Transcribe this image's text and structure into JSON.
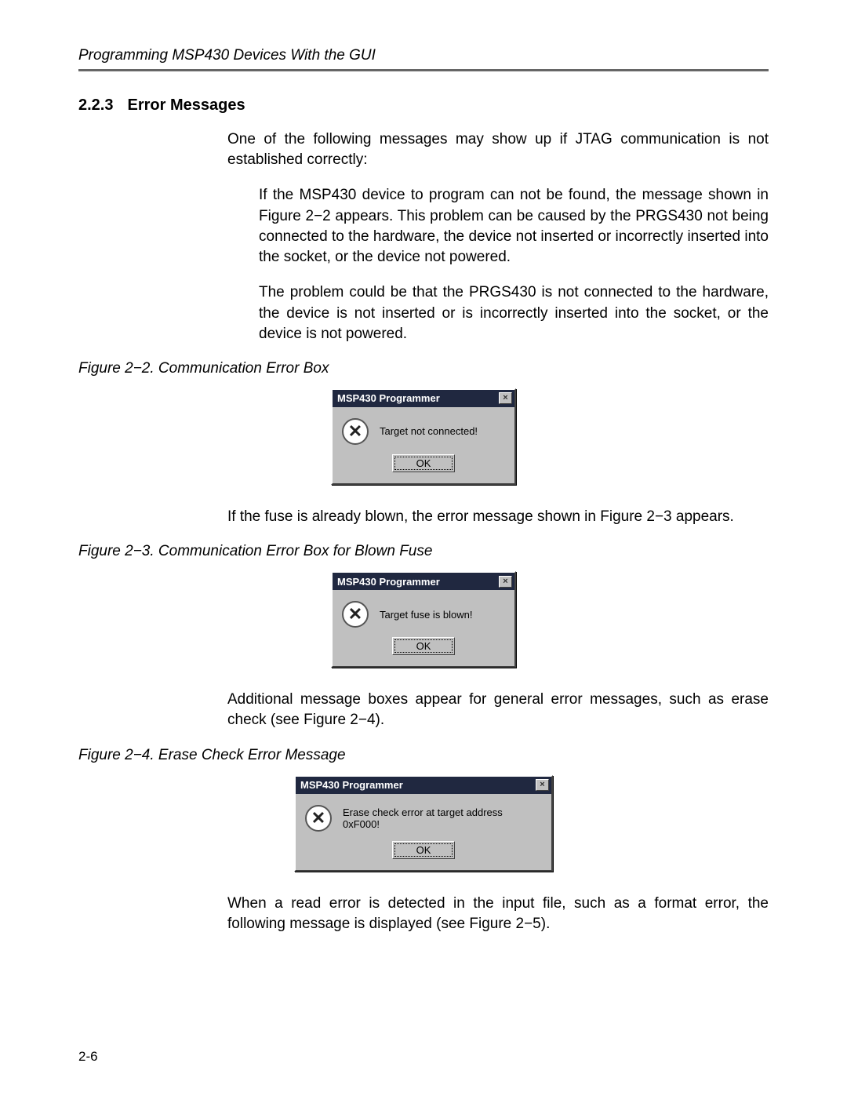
{
  "running_header": "Programming MSP430 Devices With the GUI",
  "section": {
    "number": "2.2.3",
    "title": "Error Messages"
  },
  "paragraphs": {
    "intro": "One of the following messages may show up if JTAG communication is not established correctly:",
    "p1": "If the MSP430 device to program can not be found, the message shown in Figure 2−2 appears. This problem can be caused by the PRGS430 not being connected to the hardware, the device not inserted or incorrectly inserted into the socket, or the device not powered.",
    "p2": "The problem could be that the PRGS430 is not connected to the hardware, the device is not inserted or is incorrectly inserted into the socket, or the device is not powered.",
    "p3": "If the fuse is already blown, the error message shown in Figure 2−3 appears.",
    "p4": "Additional message boxes appear for general error messages, such as erase check (see Figure 2−4).",
    "p5": "When a read error is detected in the input file, such as a format error, the following message is displayed (see Figure 2−5)."
  },
  "figures": {
    "f2": {
      "caption": "Figure 2−2. Communication Error Box"
    },
    "f3": {
      "caption": "Figure 2−3. Communication Error Box for Blown Fuse"
    },
    "f4": {
      "caption": "Figure 2−4. Erase Check Error Message"
    }
  },
  "dialogs": {
    "title": "MSP430 Programmer",
    "icon_glyph": "✕",
    "close_glyph": "×",
    "ok_label": "OK",
    "d1_msg": "Target not connected!",
    "d2_msg": "Target fuse is blown!",
    "d3_msg": "Erase check error at target address 0xF000!"
  },
  "page_number": "2-6"
}
